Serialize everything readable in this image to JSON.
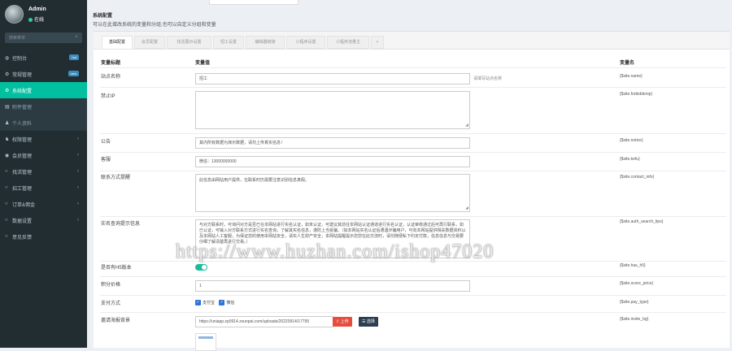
{
  "user": {
    "name": "Admin",
    "status": "在线"
  },
  "search": {
    "placeholder": "搜索菜单"
  },
  "sidebar": {
    "items": [
      {
        "label": "控制台",
        "icon": "dashboard-icon",
        "badge": "hot",
        "badge_color": "#3c8dbc"
      },
      {
        "label": "常规管理",
        "icon": "cogs-icon",
        "badge": "new",
        "badge_color": "#3c8dbc"
      },
      {
        "label": "系统配置",
        "icon": "cog-icon",
        "active": true
      },
      {
        "label": "附件管理",
        "icon": "file-icon"
      },
      {
        "label": "个人资料",
        "icon": "user-icon"
      },
      {
        "label": "权限管理",
        "icon": "group-icon"
      },
      {
        "label": "会员管理",
        "icon": "user-circle-icon"
      },
      {
        "label": "找活管理",
        "icon": "circle-icon"
      },
      {
        "label": "招工管理",
        "icon": "circle-icon"
      },
      {
        "label": "订单&佣金",
        "icon": "circle-icon"
      },
      {
        "label": "数据设置",
        "icon": "circle-icon"
      },
      {
        "label": "意见反馈",
        "icon": "circle-icon"
      }
    ]
  },
  "header": {
    "title": "系统配置",
    "desc": "可以在此增改系统的变量和分组,也可以自定义分组和变量"
  },
  "tabs": [
    "基础配置",
    "会员配置",
    "找活展示设置",
    "招工设置",
    "编辑器链接",
    "小程序设置",
    "小程序流量主",
    "+"
  ],
  "columns": {
    "title": "变量标题",
    "value": "变量值",
    "name": "变量名"
  },
  "rows": {
    "name": {
      "label": "站点名称",
      "value": "招工",
      "tip": "请填写站点名称",
      "var": "{$site.name}"
    },
    "forbiddenip": {
      "label": "禁止IP",
      "var": "{$site.forbiddenip}"
    },
    "notice": {
      "label": "公告",
      "value": "其内所有数据为演示数据，请勿上传真实信息！",
      "var": "{$site.notice}"
    },
    "kefu": {
      "label": "客服",
      "value": "微信：13000000000",
      "var": "{$site.kefu}"
    },
    "contact_info": {
      "label": "联系方式提醒",
      "value": "此信息由网站用户提供，在联系时仍需要注意识别信息真假。",
      "var": "{$site.contact_info}"
    },
    "auth_search_tips": {
      "label": "实名查询提示信息",
      "value": "与对方联系时，可询问对方是否已在本网站进行实名认证，如未认证，可建议其前往本网站认证通道进行实名认证，认证审核通过后可再行联系，如已认证，可输入对方联系方式进行实名查询，了解其实名信息，谨防上当受骗。（如本网站实名认证后遭遇诈骗用户，可向本网站提供相关数据资料以及本网站人工客服，为保证您的使用本网站安全，请实人生财产安全，本网站提醒提示您您在此交流时，请勿随便私下约定付款，信息信息与交易要仔细了解清楚再进行交易。）",
      "var": "{$site.auth_search_tips}"
    },
    "has_h5": {
      "label": "是否有H5版本",
      "on": true,
      "var": "{$site.has_h5}"
    },
    "score_price": {
      "label": "积分价格",
      "value": "1",
      "var": "{$site.score_price}"
    },
    "pay_type": {
      "label": "支付方式",
      "options": [
        "支付宝",
        "微信"
      ],
      "var": "{$site.pay_type}"
    },
    "invite_bg": {
      "label": "邀请海报背景",
      "value": "https://uniapp.zp0914.zxunpai.com/uploads/20220914/17795",
      "upload": "上传",
      "choose": "选择",
      "var": "{$site.invite_bg}"
    }
  },
  "watermark": "https://www.huzhan.com/ishop47020",
  "colors": {
    "sidebar": "#222d32",
    "active": "#00c0a0",
    "upload": "#e74c3c",
    "choose": "#2c3e50",
    "toggle": "#18bc9c"
  }
}
